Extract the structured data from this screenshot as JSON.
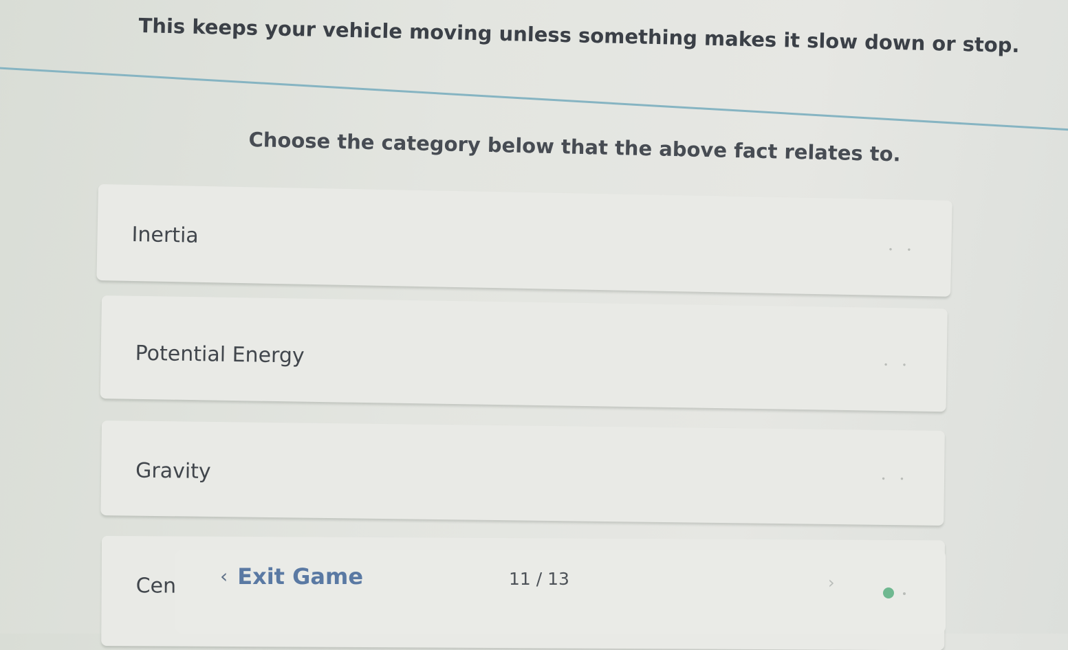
{
  "question": {
    "fact": "This keeps your vehicle moving unless something makes it slow down or stop.",
    "prompt": "Choose the category below that the above fact relates to."
  },
  "options": [
    {
      "label": "Inertia"
    },
    {
      "label": "Potential Energy"
    },
    {
      "label": "Gravity"
    },
    {
      "label": "Cen"
    }
  ],
  "footer": {
    "exit_label": "Exit Game",
    "back_icon": "chevron-left-icon",
    "page_counter": "11 / 13",
    "next_icon": "chevron-right-icon",
    "status_color": "#6fb890"
  },
  "colors": {
    "divider": "#86b4c2",
    "exit_link": "#5a79a3"
  }
}
